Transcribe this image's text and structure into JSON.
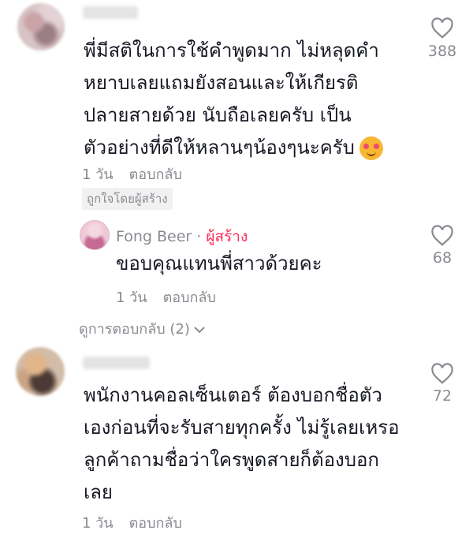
{
  "comments": [
    {
      "text_lines": [
        "พี่มีสติในการใช้คำพูดมาก ไม่หลุดคำ",
        "หยาบเลยแถมยังสอนและให้เกียรติ",
        "ปลายสายด้วย นับถือเลยครับ เป็น",
        "ตัวอย่างที่ดีให้หลานๆน้องๆนะครับ"
      ],
      "time": "1 วัน",
      "reply_label": "ตอบกลับ",
      "liked_badge": "ถูกใจโดยผู้สร้าง",
      "likes": "388"
    },
    {
      "text_lines": [
        "พนักงานคอลเซ็นเตอร์ ต้องบอกชื่อตัว",
        "เองก่อนที่จะรับสายทุกครั้ง ไม่รู้เลยเหรอ",
        "ลูกค้าถามชื่อว่าใครพูดสายก็ต้องบอก",
        "เลย"
      ],
      "time": "1 วัน",
      "reply_label": "ตอบกลับ",
      "likes": "72"
    }
  ],
  "reply": {
    "author": "Fong Beer",
    "separator": " · ",
    "creator_label": "ผู้สร้าง",
    "text": "ขอบคุณแทนพี่สาวด้วยคะ",
    "time": "1 วัน",
    "reply_label": "ตอบกลับ",
    "likes": "68"
  },
  "view_replies": "ดูการตอบกลับ (2)",
  "icons": {
    "heart": "heart-outline-icon",
    "chevron": "chevron-down-icon",
    "emoji": "smiling-face-with-hearts-emoji"
  },
  "colors": {
    "text": "#161823",
    "muted": "#8a8b91",
    "creator": "#fe2c55"
  }
}
